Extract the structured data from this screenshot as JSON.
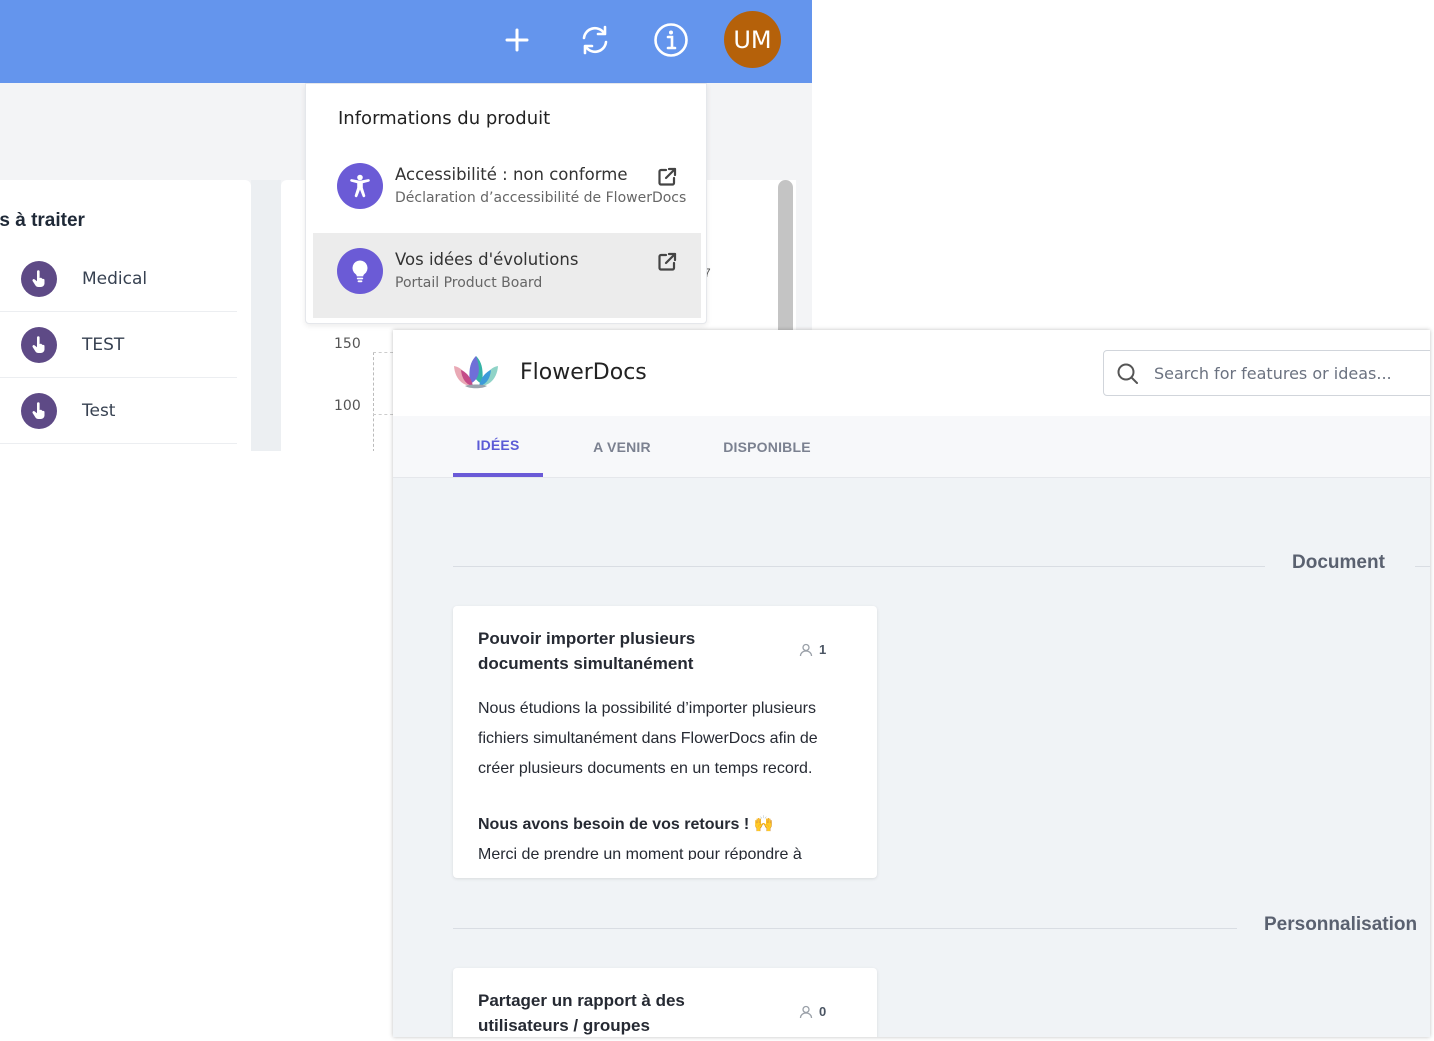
{
  "topbar": {
    "add_icon": "plus-icon",
    "refresh_icon": "refresh-icon",
    "info_icon": "info-icon",
    "avatar_initials": "UM",
    "color": "#6495ed",
    "avatar_color": "#b5610a"
  },
  "left_panel": {
    "title": "rs à traiter",
    "items": [
      {
        "label": "Medical",
        "icon": "hand-pointer-icon"
      },
      {
        "label": "TEST",
        "icon": "hand-pointer-icon"
      },
      {
        "label": "Test",
        "icon": "hand-pointer-icon"
      }
    ]
  },
  "chart_stub": {
    "y_ticks": [
      "150",
      "100"
    ],
    "partial_label": "7"
  },
  "dropdown": {
    "title": "Informations du produit",
    "items": [
      {
        "title": "Accessibilité : non conforme",
        "subtitle": "Déclaration d’accessibilité de FlowerDocs",
        "icon": "accessibility-icon",
        "action_icon": "external-link-icon"
      },
      {
        "title": "Vos idées d'évolutions",
        "subtitle": "Portail Product Board",
        "icon": "lightbulb-icon",
        "action_icon": "external-link-icon"
      }
    ],
    "accent": "#6b5bd6"
  },
  "portal": {
    "brand": "FlowerDocs",
    "search_placeholder": "Search for features or ideas...",
    "tabs": [
      "IDÉES",
      "A VENIR",
      "DISPONIBLE"
    ],
    "active_tab": "IDÉES",
    "accent": "#6a5ad7",
    "sections": [
      {
        "title": "Document",
        "cards": [
          {
            "title": "Pouvoir importer plusieurs documents simultanément",
            "votes": "1",
            "description": "Nous étudions la possibilité d’importer plusieurs fichiers simultanément dans FlowerDocs afin de créer plusieurs documents en un temps record.",
            "emphasis": "Nous avons besoin de vos retours ! 🙌",
            "truncated": "Merci de prendre un moment pour répondre à"
          }
        ]
      },
      {
        "title": "Personnalisation",
        "cards": [
          {
            "title": "Partager un rapport à des utilisateurs / groupes",
            "votes": "0"
          }
        ]
      }
    ]
  }
}
